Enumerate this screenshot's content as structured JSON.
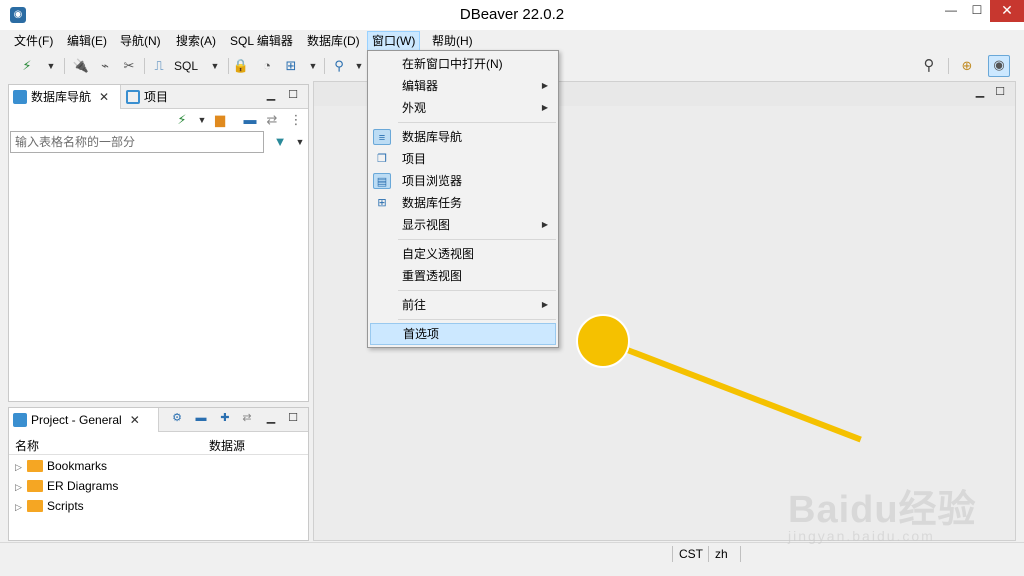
{
  "window": {
    "title": "DBeaver 22.0.2"
  },
  "menubar": {
    "items": [
      {
        "label": "文件(F)"
      },
      {
        "label": "编辑(E)"
      },
      {
        "label": "导航(N)"
      },
      {
        "label": "搜索(A)"
      },
      {
        "label": "SQL 编辑器"
      },
      {
        "label": "数据库(D)"
      },
      {
        "label": "窗口(W)"
      },
      {
        "label": "帮助(H)"
      }
    ]
  },
  "toolbar": {
    "sql_label": "SQL"
  },
  "navigator": {
    "tabs": [
      {
        "label": "数据库导航"
      },
      {
        "label": "项目"
      }
    ],
    "filter_placeholder": "输入表格名称的一部分"
  },
  "project": {
    "tab_label": "Project - General",
    "columns": [
      "名称",
      "数据源"
    ],
    "items": [
      {
        "label": "Bookmarks"
      },
      {
        "label": "ER Diagrams"
      },
      {
        "label": "Scripts"
      }
    ]
  },
  "window_menu": {
    "items": [
      {
        "label": "在新窗口中打开(N)"
      },
      {
        "label": "编辑器"
      },
      {
        "label": "外观"
      },
      {
        "label": "数据库导航"
      },
      {
        "label": "项目"
      },
      {
        "label": "项目浏览器"
      },
      {
        "label": "数据库任务"
      },
      {
        "label": "显示视图"
      },
      {
        "label": "自定义透视图"
      },
      {
        "label": "重置透视图"
      },
      {
        "label": "前往"
      },
      {
        "label": "首选项"
      }
    ]
  },
  "status": {
    "timezone": "CST",
    "locale": "zh"
  },
  "watermark": {
    "brand": "Baidu经验",
    "url": "jingyan.baidu.com"
  },
  "colors": {
    "highlight": "#cce8ff",
    "pointer": "#f5c100"
  }
}
